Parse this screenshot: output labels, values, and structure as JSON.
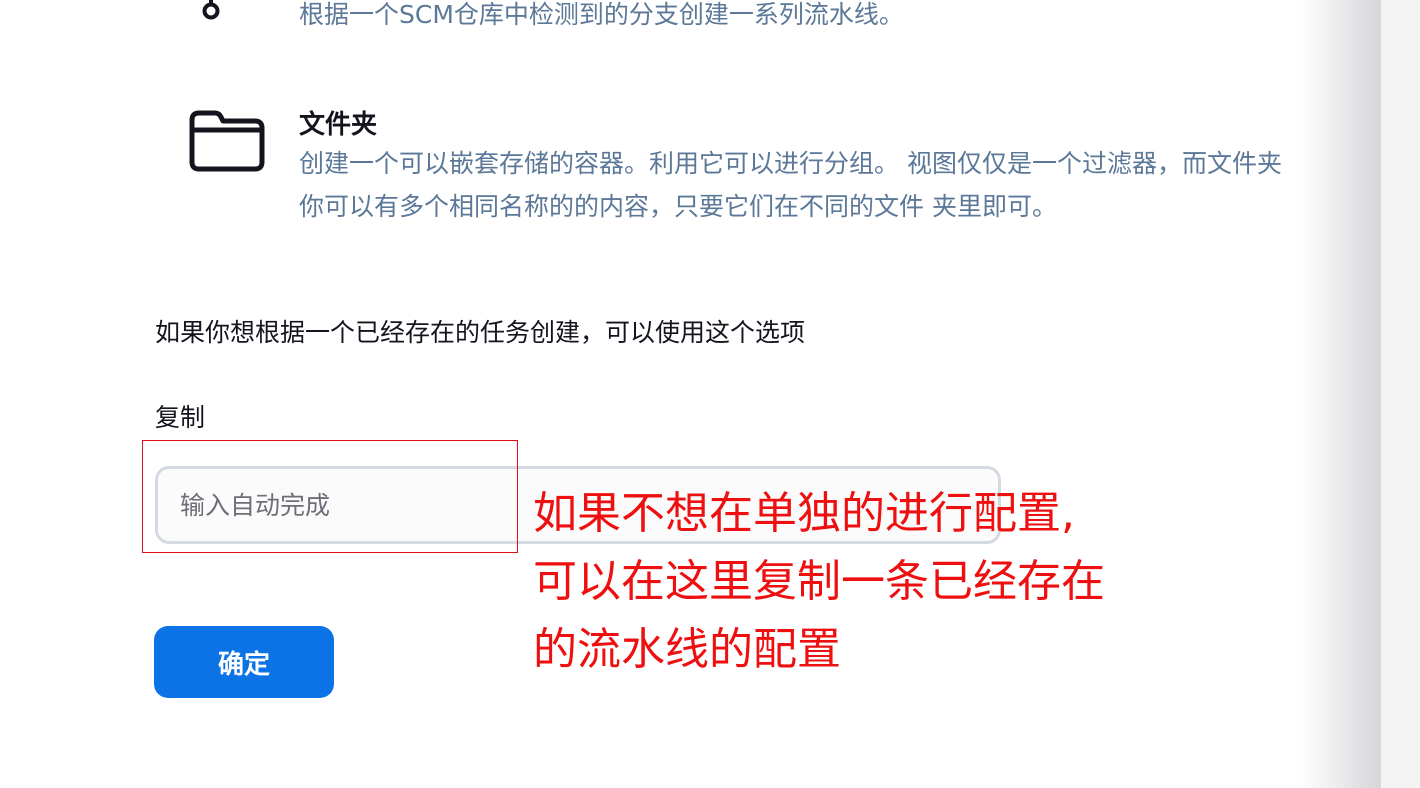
{
  "items": [
    {
      "icon": "branch-icon",
      "description_lines": [
        "根据一个SCM仓库中检测到的分支创建一系列流水线。"
      ]
    },
    {
      "icon": "folder-icon",
      "title": "文件夹",
      "description_lines": [
        "创建一个可以嵌套存储的容器。利用它可以进行分组。 视图仅仅是一个过滤器，而文件夹",
        "你可以有多个相同名称的的内容，只要它们在不同的文件 夹里即可。"
      ]
    }
  ],
  "copy": {
    "hint": "如果你想根据一个已经存在的任务创建，可以使用这个选项",
    "label": "复制",
    "input_value": "",
    "input_placeholder": "输入自动完成"
  },
  "ok_button": {
    "label": "确定"
  },
  "annotation": {
    "color": "#ee1010",
    "lines": [
      "如果不想在单独的进行配置,",
      "可以在这里复制一条已经存在",
      "的流水线的配置"
    ]
  },
  "colors": {
    "accent": "#0b73e6",
    "description": "#5c7898",
    "input_border": "#d5dae2"
  }
}
